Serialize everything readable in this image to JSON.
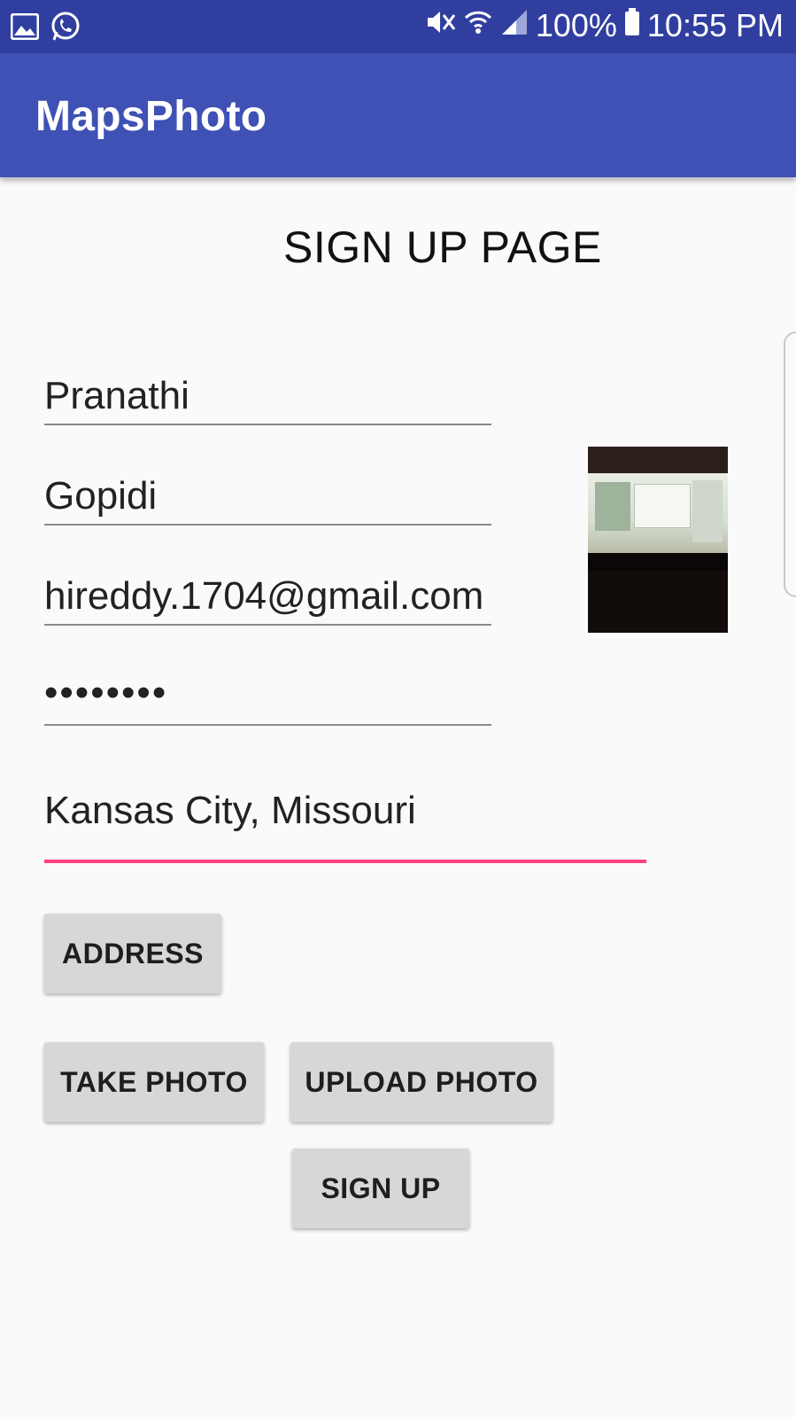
{
  "status_bar": {
    "left_icons": [
      "gallery-icon",
      "whatsapp-icon"
    ],
    "right_icons": [
      "mute-icon",
      "wifi-icon",
      "signal-icon",
      "battery-icon"
    ],
    "battery": "100%",
    "time": "10:55 PM"
  },
  "app_bar": {
    "title": "MapsPhoto"
  },
  "page": {
    "title": "SIGN UP PAGE"
  },
  "form": {
    "first_name": "Pranathi",
    "last_name": "Gopidi",
    "email": "hireddy.1704@gmail.com",
    "password": "••••••••",
    "address": "Kansas City, Missouri"
  },
  "buttons": {
    "address": "ADDRESS",
    "take_photo": "TAKE PHOTO",
    "upload_photo": "UPLOAD PHOTO",
    "sign_up": "SIGN UP"
  },
  "colors": {
    "status_bar": "#303f9f",
    "app_bar": "#3f51b5",
    "accent": "#ff4081",
    "button": "#d6d7d7"
  }
}
